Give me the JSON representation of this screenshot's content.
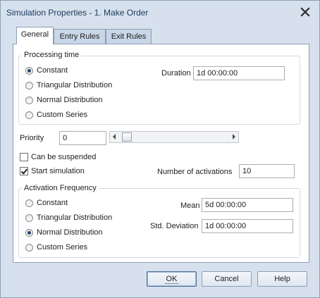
{
  "window": {
    "title": "Simulation Properties - 1. Make Order"
  },
  "tabs": [
    {
      "label": "General",
      "active": true
    },
    {
      "label": "Entry Rules",
      "active": false
    },
    {
      "label": "Exit Rules",
      "active": false
    }
  ],
  "processing": {
    "legend": "Processing time",
    "options": [
      "Constant",
      "Triangular Distribution",
      "Normal Distribution",
      "Custom Series"
    ],
    "selected": "Constant",
    "duration_label": "Duration",
    "duration_value": "1d 00:00:00"
  },
  "priority": {
    "label": "Priority",
    "value": "0",
    "slider_fraction": 0.0
  },
  "options": {
    "can_be_suspended": {
      "label": "Can be suspended",
      "checked": false
    },
    "start_simulation": {
      "label": "Start simulation",
      "checked": true
    },
    "activations_label": "Number of activations",
    "activations_value": "10"
  },
  "activation": {
    "legend": "Activation Frequency",
    "options": [
      "Constant",
      "Triangular Distribution",
      "Normal Distribution",
      "Custom Series"
    ],
    "selected": "Normal Distribution",
    "mean_label": "Mean",
    "mean_value": "5d 00:00:00",
    "stddev_label": "Std. Deviation",
    "stddev_value": "1d 00:00:00"
  },
  "buttons": {
    "ok": "OK",
    "cancel": "Cancel",
    "help": "Help"
  },
  "colors": {
    "title_text": "#1e395b",
    "window_bg": "#d7e1ee",
    "radio_dot": "#25406a"
  },
  "icons": {
    "close": "close-icon"
  }
}
